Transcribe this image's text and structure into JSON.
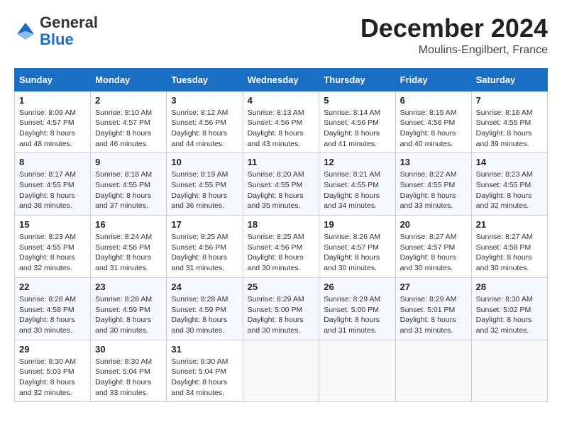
{
  "header": {
    "logo_general": "General",
    "logo_blue": "Blue",
    "month_title": "December 2024",
    "location": "Moulins-Engilbert, France"
  },
  "days_of_week": [
    "Sunday",
    "Monday",
    "Tuesday",
    "Wednesday",
    "Thursday",
    "Friday",
    "Saturday"
  ],
  "weeks": [
    [
      {
        "day": 1,
        "sunrise": "8:09 AM",
        "sunset": "4:57 PM",
        "daylight": "8 hours and 48 minutes."
      },
      {
        "day": 2,
        "sunrise": "8:10 AM",
        "sunset": "4:57 PM",
        "daylight": "8 hours and 46 minutes."
      },
      {
        "day": 3,
        "sunrise": "8:12 AM",
        "sunset": "4:56 PM",
        "daylight": "8 hours and 44 minutes."
      },
      {
        "day": 4,
        "sunrise": "8:13 AM",
        "sunset": "4:56 PM",
        "daylight": "8 hours and 43 minutes."
      },
      {
        "day": 5,
        "sunrise": "8:14 AM",
        "sunset": "4:56 PM",
        "daylight": "8 hours and 41 minutes."
      },
      {
        "day": 6,
        "sunrise": "8:15 AM",
        "sunset": "4:56 PM",
        "daylight": "8 hours and 40 minutes."
      },
      {
        "day": 7,
        "sunrise": "8:16 AM",
        "sunset": "4:55 PM",
        "daylight": "8 hours and 39 minutes."
      }
    ],
    [
      {
        "day": 8,
        "sunrise": "8:17 AM",
        "sunset": "4:55 PM",
        "daylight": "8 hours and 38 minutes."
      },
      {
        "day": 9,
        "sunrise": "8:18 AM",
        "sunset": "4:55 PM",
        "daylight": "8 hours and 37 minutes."
      },
      {
        "day": 10,
        "sunrise": "8:19 AM",
        "sunset": "4:55 PM",
        "daylight": "8 hours and 36 minutes."
      },
      {
        "day": 11,
        "sunrise": "8:20 AM",
        "sunset": "4:55 PM",
        "daylight": "8 hours and 35 minutes."
      },
      {
        "day": 12,
        "sunrise": "8:21 AM",
        "sunset": "4:55 PM",
        "daylight": "8 hours and 34 minutes."
      },
      {
        "day": 13,
        "sunrise": "8:22 AM",
        "sunset": "4:55 PM",
        "daylight": "8 hours and 33 minutes."
      },
      {
        "day": 14,
        "sunrise": "8:23 AM",
        "sunset": "4:55 PM",
        "daylight": "8 hours and 32 minutes."
      }
    ],
    [
      {
        "day": 15,
        "sunrise": "8:23 AM",
        "sunset": "4:55 PM",
        "daylight": "8 hours and 32 minutes."
      },
      {
        "day": 16,
        "sunrise": "8:24 AM",
        "sunset": "4:56 PM",
        "daylight": "8 hours and 31 minutes."
      },
      {
        "day": 17,
        "sunrise": "8:25 AM",
        "sunset": "4:56 PM",
        "daylight": "8 hours and 31 minutes."
      },
      {
        "day": 18,
        "sunrise": "8:25 AM",
        "sunset": "4:56 PM",
        "daylight": "8 hours and 30 minutes."
      },
      {
        "day": 19,
        "sunrise": "8:26 AM",
        "sunset": "4:57 PM",
        "daylight": "8 hours and 30 minutes."
      },
      {
        "day": 20,
        "sunrise": "8:27 AM",
        "sunset": "4:57 PM",
        "daylight": "8 hours and 30 minutes."
      },
      {
        "day": 21,
        "sunrise": "8:27 AM",
        "sunset": "4:58 PM",
        "daylight": "8 hours and 30 minutes."
      }
    ],
    [
      {
        "day": 22,
        "sunrise": "8:28 AM",
        "sunset": "4:58 PM",
        "daylight": "8 hours and 30 minutes."
      },
      {
        "day": 23,
        "sunrise": "8:28 AM",
        "sunset": "4:59 PM",
        "daylight": "8 hours and 30 minutes."
      },
      {
        "day": 24,
        "sunrise": "8:28 AM",
        "sunset": "4:59 PM",
        "daylight": "8 hours and 30 minutes."
      },
      {
        "day": 25,
        "sunrise": "8:29 AM",
        "sunset": "5:00 PM",
        "daylight": "8 hours and 30 minutes."
      },
      {
        "day": 26,
        "sunrise": "8:29 AM",
        "sunset": "5:00 PM",
        "daylight": "8 hours and 31 minutes."
      },
      {
        "day": 27,
        "sunrise": "8:29 AM",
        "sunset": "5:01 PM",
        "daylight": "8 hours and 31 minutes."
      },
      {
        "day": 28,
        "sunrise": "8:30 AM",
        "sunset": "5:02 PM",
        "daylight": "8 hours and 32 minutes."
      }
    ],
    [
      {
        "day": 29,
        "sunrise": "8:30 AM",
        "sunset": "5:03 PM",
        "daylight": "8 hours and 32 minutes."
      },
      {
        "day": 30,
        "sunrise": "8:30 AM",
        "sunset": "5:04 PM",
        "daylight": "8 hours and 33 minutes."
      },
      {
        "day": 31,
        "sunrise": "8:30 AM",
        "sunset": "5:04 PM",
        "daylight": "8 hours and 34 minutes."
      },
      null,
      null,
      null,
      null
    ]
  ]
}
